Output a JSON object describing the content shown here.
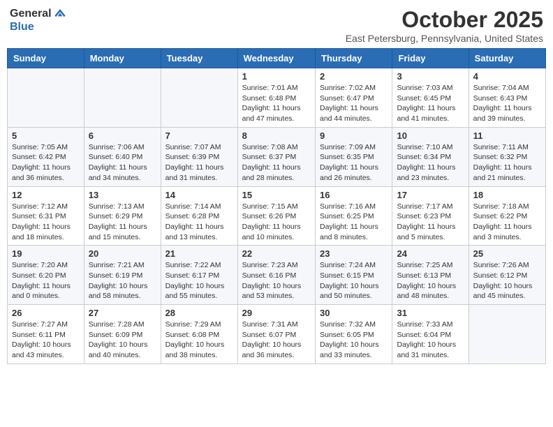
{
  "header": {
    "logo_general": "General",
    "logo_blue": "Blue",
    "month": "October 2025",
    "location": "East Petersburg, Pennsylvania, United States"
  },
  "days_of_week": [
    "Sunday",
    "Monday",
    "Tuesday",
    "Wednesday",
    "Thursday",
    "Friday",
    "Saturday"
  ],
  "weeks": [
    [
      {
        "day": "",
        "info": ""
      },
      {
        "day": "",
        "info": ""
      },
      {
        "day": "",
        "info": ""
      },
      {
        "day": "1",
        "info": "Sunrise: 7:01 AM\nSunset: 6:48 PM\nDaylight: 11 hours and 47 minutes."
      },
      {
        "day": "2",
        "info": "Sunrise: 7:02 AM\nSunset: 6:47 PM\nDaylight: 11 hours and 44 minutes."
      },
      {
        "day": "3",
        "info": "Sunrise: 7:03 AM\nSunset: 6:45 PM\nDaylight: 11 hours and 41 minutes."
      },
      {
        "day": "4",
        "info": "Sunrise: 7:04 AM\nSunset: 6:43 PM\nDaylight: 11 hours and 39 minutes."
      }
    ],
    [
      {
        "day": "5",
        "info": "Sunrise: 7:05 AM\nSunset: 6:42 PM\nDaylight: 11 hours and 36 minutes."
      },
      {
        "day": "6",
        "info": "Sunrise: 7:06 AM\nSunset: 6:40 PM\nDaylight: 11 hours and 34 minutes."
      },
      {
        "day": "7",
        "info": "Sunrise: 7:07 AM\nSunset: 6:39 PM\nDaylight: 11 hours and 31 minutes."
      },
      {
        "day": "8",
        "info": "Sunrise: 7:08 AM\nSunset: 6:37 PM\nDaylight: 11 hours and 28 minutes."
      },
      {
        "day": "9",
        "info": "Sunrise: 7:09 AM\nSunset: 6:35 PM\nDaylight: 11 hours and 26 minutes."
      },
      {
        "day": "10",
        "info": "Sunrise: 7:10 AM\nSunset: 6:34 PM\nDaylight: 11 hours and 23 minutes."
      },
      {
        "day": "11",
        "info": "Sunrise: 7:11 AM\nSunset: 6:32 PM\nDaylight: 11 hours and 21 minutes."
      }
    ],
    [
      {
        "day": "12",
        "info": "Sunrise: 7:12 AM\nSunset: 6:31 PM\nDaylight: 11 hours and 18 minutes."
      },
      {
        "day": "13",
        "info": "Sunrise: 7:13 AM\nSunset: 6:29 PM\nDaylight: 11 hours and 15 minutes."
      },
      {
        "day": "14",
        "info": "Sunrise: 7:14 AM\nSunset: 6:28 PM\nDaylight: 11 hours and 13 minutes."
      },
      {
        "day": "15",
        "info": "Sunrise: 7:15 AM\nSunset: 6:26 PM\nDaylight: 11 hours and 10 minutes."
      },
      {
        "day": "16",
        "info": "Sunrise: 7:16 AM\nSunset: 6:25 PM\nDaylight: 11 hours and 8 minutes."
      },
      {
        "day": "17",
        "info": "Sunrise: 7:17 AM\nSunset: 6:23 PM\nDaylight: 11 hours and 5 minutes."
      },
      {
        "day": "18",
        "info": "Sunrise: 7:18 AM\nSunset: 6:22 PM\nDaylight: 11 hours and 3 minutes."
      }
    ],
    [
      {
        "day": "19",
        "info": "Sunrise: 7:20 AM\nSunset: 6:20 PM\nDaylight: 11 hours and 0 minutes."
      },
      {
        "day": "20",
        "info": "Sunrise: 7:21 AM\nSunset: 6:19 PM\nDaylight: 10 hours and 58 minutes."
      },
      {
        "day": "21",
        "info": "Sunrise: 7:22 AM\nSunset: 6:17 PM\nDaylight: 10 hours and 55 minutes."
      },
      {
        "day": "22",
        "info": "Sunrise: 7:23 AM\nSunset: 6:16 PM\nDaylight: 10 hours and 53 minutes."
      },
      {
        "day": "23",
        "info": "Sunrise: 7:24 AM\nSunset: 6:15 PM\nDaylight: 10 hours and 50 minutes."
      },
      {
        "day": "24",
        "info": "Sunrise: 7:25 AM\nSunset: 6:13 PM\nDaylight: 10 hours and 48 minutes."
      },
      {
        "day": "25",
        "info": "Sunrise: 7:26 AM\nSunset: 6:12 PM\nDaylight: 10 hours and 45 minutes."
      }
    ],
    [
      {
        "day": "26",
        "info": "Sunrise: 7:27 AM\nSunset: 6:11 PM\nDaylight: 10 hours and 43 minutes."
      },
      {
        "day": "27",
        "info": "Sunrise: 7:28 AM\nSunset: 6:09 PM\nDaylight: 10 hours and 40 minutes."
      },
      {
        "day": "28",
        "info": "Sunrise: 7:29 AM\nSunset: 6:08 PM\nDaylight: 10 hours and 38 minutes."
      },
      {
        "day": "29",
        "info": "Sunrise: 7:31 AM\nSunset: 6:07 PM\nDaylight: 10 hours and 36 minutes."
      },
      {
        "day": "30",
        "info": "Sunrise: 7:32 AM\nSunset: 6:05 PM\nDaylight: 10 hours and 33 minutes."
      },
      {
        "day": "31",
        "info": "Sunrise: 7:33 AM\nSunset: 6:04 PM\nDaylight: 10 hours and 31 minutes."
      },
      {
        "day": "",
        "info": ""
      }
    ]
  ]
}
